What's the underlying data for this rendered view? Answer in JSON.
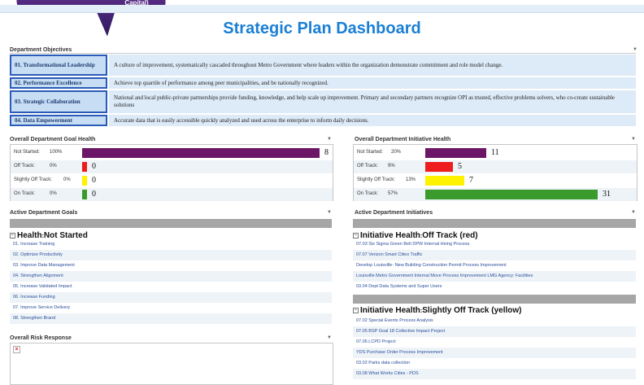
{
  "callout": {
    "text": "Capital)"
  },
  "page_title": "Strategic Plan Dashboard",
  "objectives": {
    "title": "Department Objectives",
    "items": [
      {
        "label": "01. Transformational Leadership",
        "text": "A culture of improvement, systematically cascaded throughout Metro Government where leaders within the organization demonstrate commitment and role model change."
      },
      {
        "label": "02. Performance Excellence",
        "text": "Achieve top quartile of performance among peer municipalities, and be nationally recognized."
      },
      {
        "label": "03. Strategic Collaboration",
        "text": "National and local public-private partnerships provide funding, knowledge, and help scale up improvement. Primary and secondary partners recognize OPI as trusted, effective problems solvers, who co-create sustainable solutions"
      },
      {
        "label": "04. Data Empowerment",
        "text": "Accurate data that is easily accessible quickly analyzed and used across the enterprise to inform daily decisions."
      }
    ]
  },
  "goal_health": {
    "title": "Overall Department Goal Health",
    "rows": [
      {
        "label": "Not Started:",
        "pct": "100%",
        "count": "8",
        "value": 8,
        "color": "#6b1666"
      },
      {
        "label": "Off Track:",
        "pct": "0%",
        "count": "0",
        "value": 0,
        "color": "#ee1c1c"
      },
      {
        "label": "Slightly Off Track:",
        "pct": "0%",
        "count": "0",
        "value": 0,
        "color": "#fff200"
      },
      {
        "label": "On Track:",
        "pct": "0%",
        "count": "0",
        "value": 0,
        "color": "#3a9a2c"
      }
    ]
  },
  "initiative_health": {
    "title": "Overall Department Initiative Health",
    "rows": [
      {
        "label": "Not Started:",
        "pct": "20%",
        "count": "11",
        "value": 11,
        "color": "#6b1666"
      },
      {
        "label": "Off Track:",
        "pct": "9%",
        "count": "5",
        "value": 5,
        "color": "#ee1c1c"
      },
      {
        "label": "Slightly Off Track:",
        "pct": "13%",
        "count": "7",
        "value": 7,
        "color": "#fff200"
      },
      {
        "label": "On Track:",
        "pct": "57%",
        "count": "31",
        "value": 31,
        "color": "#3a9a2c"
      }
    ]
  },
  "active_goals": {
    "title": "Active Department Goals",
    "group_prefix": "Health",
    "group_value": "Not Started",
    "items": [
      "01. Increase Training",
      "02. Optimize Productivity",
      "03. Improve Data Management",
      "04. Strengthen Alignment",
      "05. Increase Validated Impact",
      "06. Increase Funding",
      "07. Improve Service Delivery",
      "08. Strengthen Brand"
    ]
  },
  "risk_response": {
    "title": "Overall Risk Response"
  },
  "active_initiatives": {
    "title": "Active Department Initiatives",
    "group1_prefix": "Initiative Health",
    "group1_value": "Off Track (red)",
    "group1_items": [
      "07.03 Six Sigma Green Belt DPW Internal Hiring Process",
      "07.07 Verizon Smart Cities Traffic",
      "Develop Louisville- New Building Construction Permit Process Improvement",
      "Louisville Metro Government Internal Move Process Improvement LMG Agency: Facilities",
      "03.04 Dept Data Systems and Super Users"
    ],
    "group2_prefix": "Initiative Health",
    "group2_value": "Slightly Off Track (yellow)",
    "group2_items": [
      "07.02 Special Events Process Analysis",
      "07.05 BSP Goal 18 Collective Impact Project",
      "07.06 LCPD Project",
      "YDS Purchase Order Process Improvement",
      "03.02 Parks data collection",
      "03.08 What Works Cities - PDS"
    ]
  }
}
